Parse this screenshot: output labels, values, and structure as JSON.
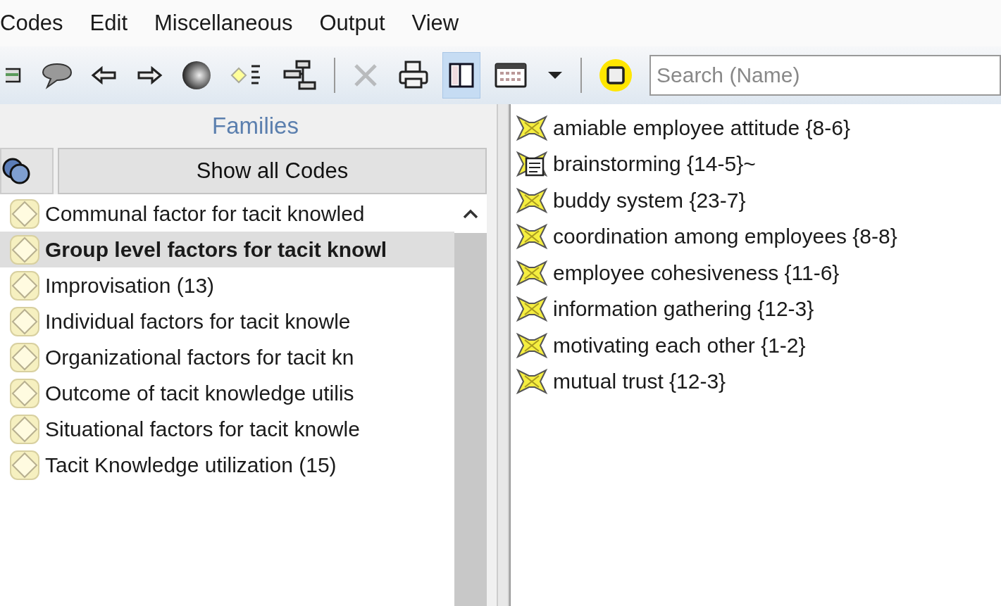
{
  "menu": [
    "Codes",
    "Edit",
    "Miscellaneous",
    "Output",
    "View"
  ],
  "toolbar": [
    {
      "kind": "list"
    },
    {
      "kind": "comment"
    },
    {
      "kind": "back"
    },
    {
      "kind": "forward"
    },
    {
      "kind": "sphere"
    },
    {
      "kind": "diamond-list"
    },
    {
      "kind": "tree"
    },
    {
      "kind": "separator"
    },
    {
      "kind": "delete",
      "disabled": true
    },
    {
      "kind": "print"
    },
    {
      "kind": "split",
      "pressed": true
    },
    {
      "kind": "grid"
    },
    {
      "kind": "dropdown"
    },
    {
      "kind": "separator"
    },
    {
      "kind": "highlight"
    }
  ],
  "search": {
    "placeholder": "Search (Name)"
  },
  "families": {
    "title": "Families",
    "show_all_button": "Show all Codes",
    "items": [
      {
        "label": "Communal factor for tacit knowled",
        "selected": false
      },
      {
        "label": "Group level factors for tacit knowl",
        "selected": true
      },
      {
        "label": "Improvisation (13)",
        "selected": false
      },
      {
        "label": "Individual factors for tacit knowle",
        "selected": false
      },
      {
        "label": "Organizational factors for tacit kn",
        "selected": false
      },
      {
        "label": "Outcome of tacit knowledge utilis",
        "selected": false
      },
      {
        "label": "Situational factors for tacit knowle",
        "selected": false
      },
      {
        "label": "Tacit Knowledge utilization (15)",
        "selected": false
      }
    ]
  },
  "codes": [
    {
      "label": "amiable employee attitude {8-6}",
      "kind": "code"
    },
    {
      "label": "brainstorming {14-5}~",
      "kind": "memo-code"
    },
    {
      "label": "buddy system {23-7}",
      "kind": "code"
    },
    {
      "label": "coordination among employees {8-8}",
      "kind": "code"
    },
    {
      "label": "employee cohesiveness {11-6}",
      "kind": "code"
    },
    {
      "label": "information gathering {12-3}",
      "kind": "code"
    },
    {
      "label": "motivating each other {1-2}",
      "kind": "code"
    },
    {
      "label": "mutual trust {12-3}",
      "kind": "code"
    }
  ]
}
